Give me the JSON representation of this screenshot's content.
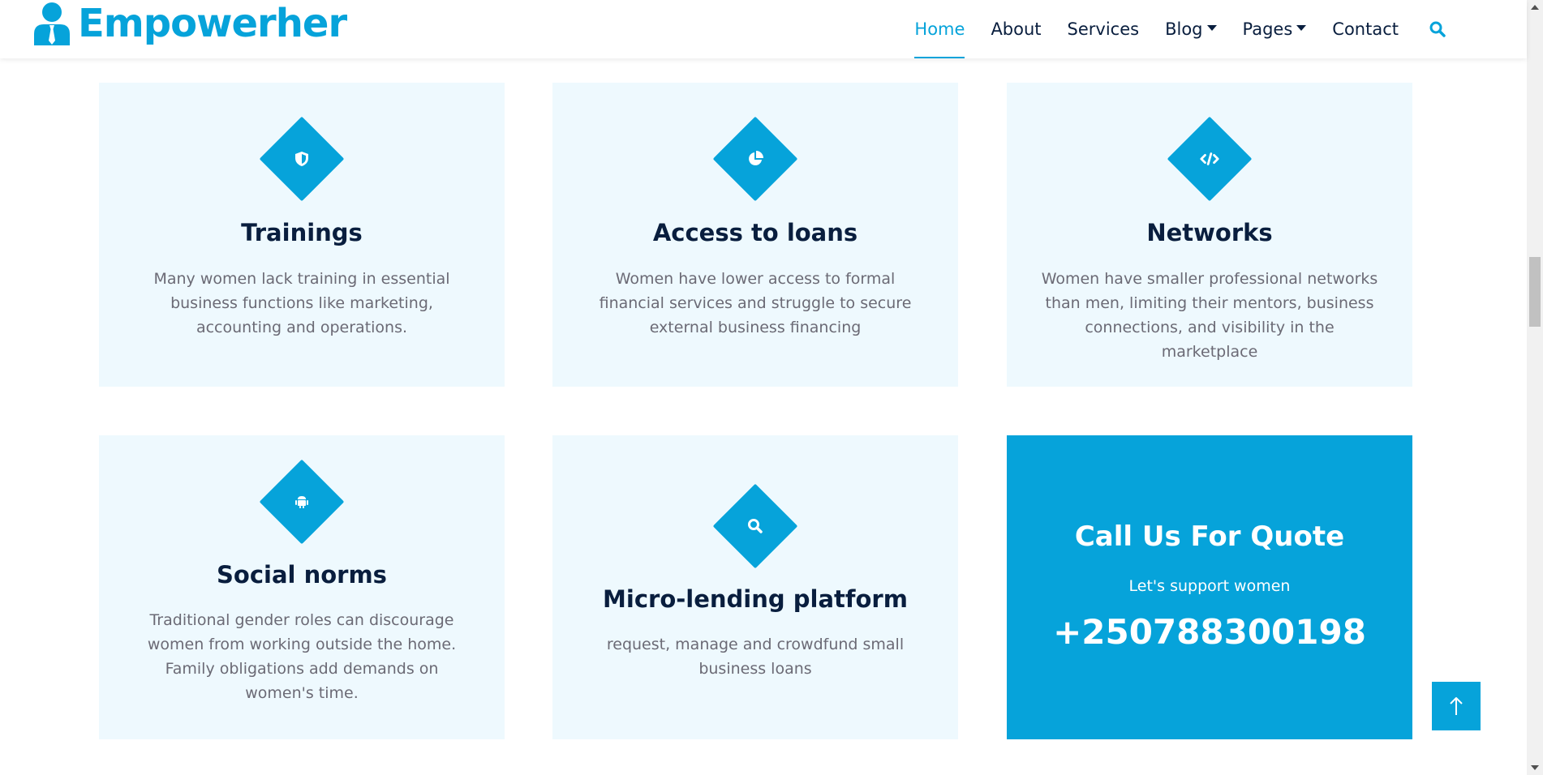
{
  "brand": {
    "name": "Empowerher",
    "icon": "user-tie-icon"
  },
  "nav": {
    "items": [
      {
        "label": "Home",
        "active": true,
        "dropdown": false
      },
      {
        "label": "About",
        "active": false,
        "dropdown": false
      },
      {
        "label": "Services",
        "active": false,
        "dropdown": false
      },
      {
        "label": "Blog",
        "active": false,
        "dropdown": true
      },
      {
        "label": "Pages",
        "active": false,
        "dropdown": true
      },
      {
        "label": "Contact",
        "active": false,
        "dropdown": false
      }
    ],
    "search_icon": "search-icon"
  },
  "cards": [
    {
      "title": "Trainings",
      "description": "Many women lack training in essential business functions like marketing, accounting and operations.",
      "icon": "shield-icon"
    },
    {
      "title": "Access to loans",
      "description": "Women have lower access to formal financial services and struggle to secure external business financing",
      "icon": "chart-pie-icon"
    },
    {
      "title": "Networks",
      "description": "Women have smaller professional networks than men, limiting their mentors, business connections, and visibility in the marketplace",
      "icon": "code-icon"
    },
    {
      "title": "Social norms",
      "description": "Traditional gender roles can discourage women from working outside the home. Family obligations add demands on women's time.",
      "icon": "android-icon"
    },
    {
      "title": "Micro-lending platform",
      "description": "request, manage and crowdfund small business loans",
      "icon": "search-icon"
    }
  ],
  "quote": {
    "title": "Call Us For Quote",
    "subtitle": "Let's support women",
    "phone": "+250788300198"
  },
  "back_to_top_icon": "arrow-up-icon",
  "colors": {
    "primary": "#06a3da",
    "dark": "#091e3e",
    "card_bg": "#eef9fe",
    "text_muted": "#6b6a75"
  }
}
